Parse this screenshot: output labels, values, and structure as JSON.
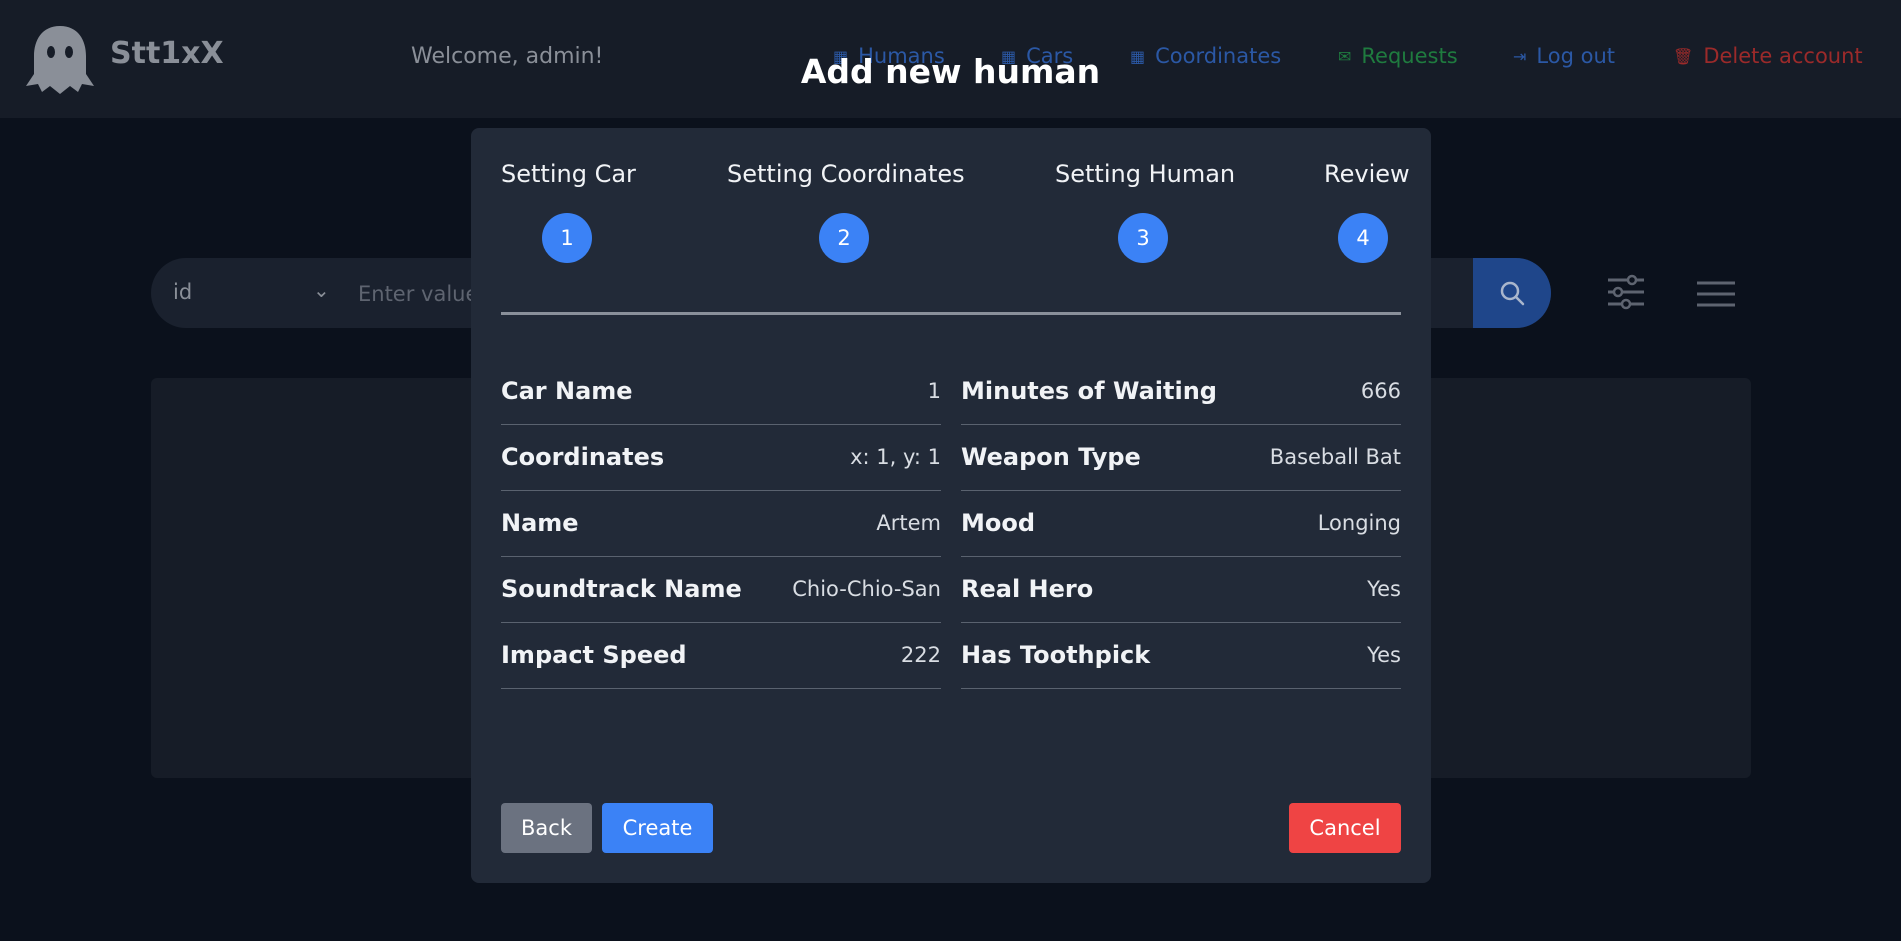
{
  "header": {
    "brand": "Stt1xX",
    "welcome": "Welcome, admin!",
    "nav": [
      {
        "label": "Humans",
        "icon": "grid-icon"
      },
      {
        "label": "Cars",
        "icon": "grid-icon"
      },
      {
        "label": "Coordinates",
        "icon": "grid-icon"
      },
      {
        "label": "Requests",
        "icon": "envelope-icon"
      },
      {
        "label": "Log out",
        "icon": "logout-icon"
      },
      {
        "label": "Delete account",
        "icon": "trash-icon"
      }
    ]
  },
  "search": {
    "field": "id",
    "placeholder": "Enter value"
  },
  "modal": {
    "title": "Add new human",
    "steps": [
      {
        "label": "Setting Car",
        "number": "1"
      },
      {
        "label": "Setting Coordinates",
        "number": "2"
      },
      {
        "label": "Setting Human",
        "number": "3"
      },
      {
        "label": "Review",
        "number": "4"
      }
    ],
    "review_left": [
      {
        "label": "Car Name",
        "value": "1"
      },
      {
        "label": "Coordinates",
        "value": "x: 1, y: 1"
      },
      {
        "label": "Name",
        "value": "Artem"
      },
      {
        "label": "Soundtrack Name",
        "value": "Chio-Chio-San"
      },
      {
        "label": "Impact Speed",
        "value": "222"
      }
    ],
    "review_right": [
      {
        "label": "Minutes of Waiting",
        "value": "666"
      },
      {
        "label": "Weapon Type",
        "value": "Baseball Bat"
      },
      {
        "label": "Mood",
        "value": "Longing"
      },
      {
        "label": "Real Hero",
        "value": "Yes"
      },
      {
        "label": "Has Toothpick",
        "value": "Yes"
      }
    ],
    "buttons": {
      "back": "Back",
      "create": "Create",
      "cancel": "Cancel"
    }
  },
  "colors": {
    "accent": "#3b82f6",
    "danger": "#ef4444",
    "neutral": "#6b7280",
    "modal_bg": "#222a38"
  }
}
